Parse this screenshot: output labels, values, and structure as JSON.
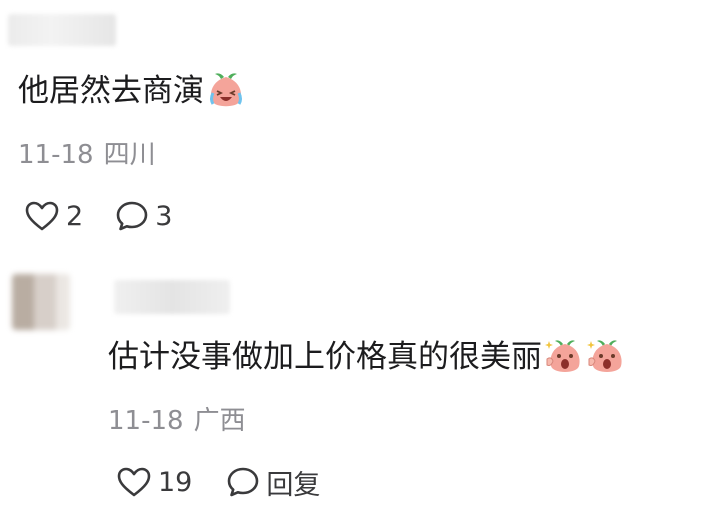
{
  "comments": [
    {
      "text": "他居然去商演",
      "emojis": [
        "crying-laughing-peach-emoji"
      ],
      "date": "11-18",
      "location": "四川",
      "likes": "2",
      "replies": "3"
    },
    {
      "text": "估计没事做加上价格真的很美丽",
      "emojis": [
        "shocked-peach-emoji",
        "shocked-peach-emoji"
      ],
      "date": "11-18",
      "location": "广西",
      "likes": "19",
      "reply_label": "回复"
    }
  ],
  "colors": {
    "text": "#1c1c1e",
    "meta": "#8e8e93",
    "peach": "#f4a49a",
    "leaf": "#4fae5b"
  }
}
